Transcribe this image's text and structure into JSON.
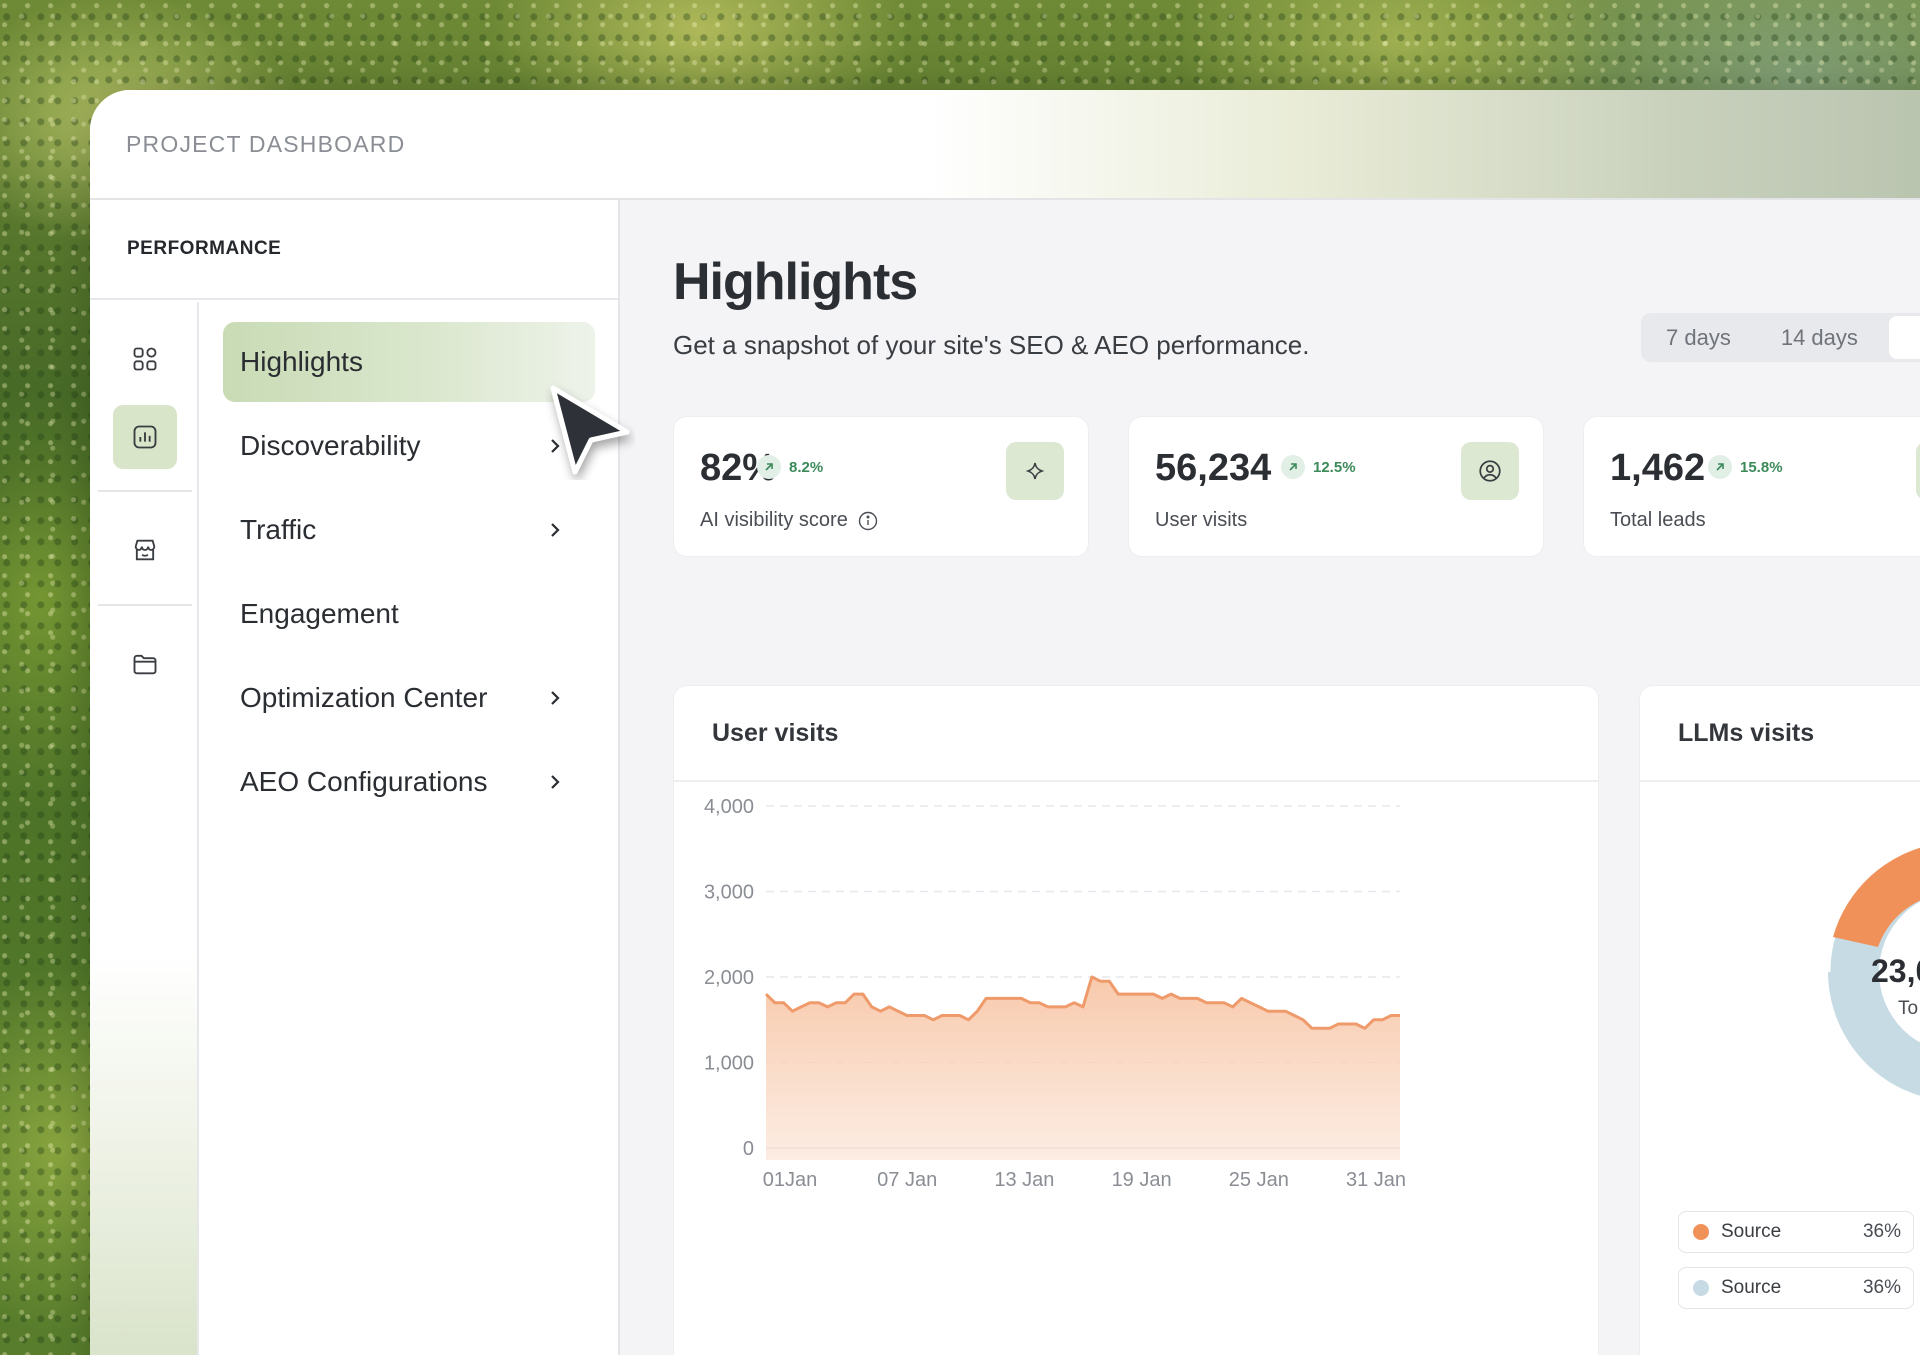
{
  "header": {
    "title": "PROJECT DASHBOARD"
  },
  "sidebar": {
    "section_label": "PERFORMANCE",
    "rail": [
      {
        "icon": "grid-icon",
        "active": false
      },
      {
        "icon": "bar-chart-icon",
        "active": true
      },
      {
        "icon": "store-icon",
        "active": false
      },
      {
        "icon": "folder-icon",
        "active": false
      }
    ],
    "items": [
      {
        "label": "Highlights",
        "active": true,
        "has_children": false
      },
      {
        "label": "Discoverability",
        "active": false,
        "has_children": true
      },
      {
        "label": "Traffic",
        "active": false,
        "has_children": true
      },
      {
        "label": "Engagement",
        "active": false,
        "has_children": false
      },
      {
        "label": "Optimization Center",
        "active": false,
        "has_children": true
      },
      {
        "label": "AEO Configurations",
        "active": false,
        "has_children": true
      }
    ]
  },
  "main": {
    "title": "Highlights",
    "subtitle": "Get a snapshot of your site's SEO & AEO performance.",
    "range_options": [
      "7 days",
      "14 days"
    ],
    "kpis": [
      {
        "value": "82%",
        "change": "8.2%",
        "label": "AI visibility score",
        "icon": "sparkle-icon",
        "info": true
      },
      {
        "value": "56,234",
        "change": "12.5%",
        "label": "User visits",
        "icon": "user-circle-icon",
        "info": false
      },
      {
        "value": "1,462",
        "change": "15.8%",
        "label": "Total leads",
        "icon": "",
        "info": false
      }
    ],
    "user_visits_card": {
      "title": "User visits"
    },
    "llm_card": {
      "title": "LLMs visits",
      "center_value": "23,0",
      "center_label": "To",
      "legend": [
        {
          "label": "Source",
          "pct": "36%",
          "color": "#f0915a"
        },
        {
          "label": "Source",
          "pct": "36%",
          "color": "#c6dbe4"
        }
      ]
    }
  },
  "chart_data": {
    "type": "area",
    "title": "User visits",
    "ylim": [
      0,
      4000
    ],
    "yticks": [
      "4,000",
      "3,000",
      "2,000",
      "1,000",
      "0"
    ],
    "xticks": [
      "01Jan",
      "07 Jan",
      "13 Jan",
      "19 Jan",
      "25 Jan",
      "31 Jan"
    ],
    "color": "#ef9a6a",
    "grid": true,
    "series": [
      {
        "values": [
          1800,
          1700,
          1700,
          1600,
          1650,
          1700,
          1700,
          1650,
          1700,
          1700,
          1800,
          1800,
          1650,
          1600,
          1650,
          1600,
          1550,
          1550,
          1550,
          1500,
          1550,
          1550,
          1550,
          1500,
          1600,
          1750,
          1750,
          1750,
          1750,
          1750,
          1700,
          1700,
          1650,
          1650,
          1650,
          1700,
          1650,
          2000,
          1950,
          1950,
          1800,
          1800,
          1800,
          1800,
          1800,
          1750,
          1800,
          1750,
          1750,
          1750,
          1700,
          1700,
          1700,
          1650,
          1750,
          1700,
          1650,
          1600,
          1600,
          1600,
          1550,
          1500,
          1400,
          1400,
          1400,
          1450,
          1450,
          1450,
          1400,
          1500,
          1500,
          1550,
          1550
        ]
      }
    ]
  }
}
